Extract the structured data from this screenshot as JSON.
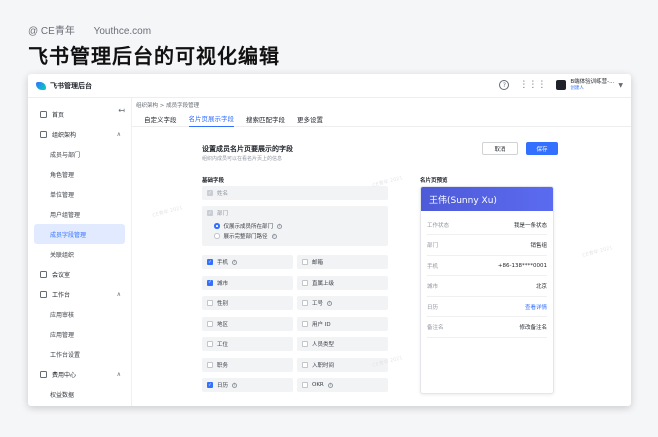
{
  "credit": {
    "brand": "@ CE青年",
    "site": "Youthce.com"
  },
  "headline": "飞书管理后台的可视化编辑",
  "topbar": {
    "app_name": "飞书管理后台",
    "help_icon": "?",
    "org_name": "B端体验训练营-...",
    "org_role": "创建人"
  },
  "sidebar": {
    "collapse_icon": "↤",
    "items": [
      {
        "label": "首页",
        "type": "top",
        "icon": "home-icon"
      },
      {
        "label": "组织架构",
        "type": "top",
        "icon": "org-icon",
        "chevron": "∧"
      },
      {
        "label": "成员与部门",
        "type": "sub"
      },
      {
        "label": "角色管理",
        "type": "sub"
      },
      {
        "label": "单位管理",
        "type": "sub"
      },
      {
        "label": "用户组管理",
        "type": "sub"
      },
      {
        "label": "成员字段管理",
        "type": "sub",
        "active": true
      },
      {
        "label": "关联组织",
        "type": "sub"
      },
      {
        "label": "会议室",
        "type": "top",
        "icon": "meeting-room-icon"
      },
      {
        "label": "工作台",
        "type": "top",
        "icon": "workbench-icon",
        "chevron": "∧"
      },
      {
        "label": "应用审核",
        "type": "sub"
      },
      {
        "label": "应用管理",
        "type": "sub"
      },
      {
        "label": "工作台设置",
        "type": "sub"
      },
      {
        "label": "费用中心",
        "type": "top",
        "icon": "billing-icon",
        "chevron": "∧"
      },
      {
        "label": "权益数据",
        "type": "sub"
      }
    ]
  },
  "breadcrumb": "组织架构 > 成员字段管理",
  "tabs": [
    "自定义字段",
    "名片页展示字段",
    "搜索匹配字段",
    "更多设置"
  ],
  "section": {
    "title": "设置成员名片页要展示的字段",
    "subtitle": "组织内成员可以在看名片页上的信息",
    "cancel": "取消",
    "save": "保存"
  },
  "base_fields": {
    "title": "基础字段",
    "name": "姓名",
    "dept": "部门",
    "dept_opt1": "仅展示成员所在部门",
    "dept_opt2": "展示完整部门路径",
    "grid": [
      {
        "label": "手机",
        "checked": true,
        "info": true
      },
      {
        "label": "邮箱",
        "checked": false
      },
      {
        "label": "城市",
        "checked": true
      },
      {
        "label": "直属上级",
        "checked": false
      },
      {
        "label": "性别",
        "checked": false
      },
      {
        "label": "工号",
        "checked": false,
        "info": true
      },
      {
        "label": "地区",
        "checked": false
      },
      {
        "label": "用户 ID",
        "checked": false
      },
      {
        "label": "工位",
        "checked": false
      },
      {
        "label": "人员类型",
        "checked": false
      },
      {
        "label": "职务",
        "checked": false
      },
      {
        "label": "入职时间",
        "checked": false
      },
      {
        "label": "日历",
        "checked": true,
        "info": true
      },
      {
        "label": "OKR",
        "checked": false,
        "info": true
      }
    ]
  },
  "preview": {
    "title": "名片页预览",
    "name": "王伟(Sunny Xu)",
    "rows": [
      {
        "k": "工作状态",
        "v": "我是一条状态"
      },
      {
        "k": "部门",
        "v": "销售组"
      },
      {
        "k": "手机",
        "v": "+86-138****0001"
      },
      {
        "k": "城市",
        "v": "北京"
      },
      {
        "k": "日历",
        "v": "查看详情",
        "link": true
      },
      {
        "k": "备注名",
        "v": "修改备注名"
      }
    ]
  },
  "colors": {
    "accent": "#3370ff",
    "card_header": "#5b6bf0"
  }
}
